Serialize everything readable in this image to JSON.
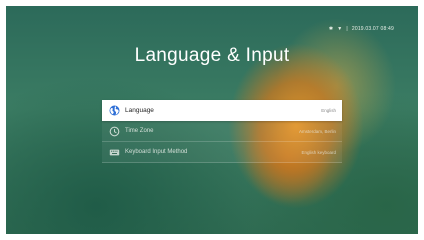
{
  "status_bar": {
    "bluetooth_icon": "bluetooth-icon",
    "wifi_icon": "wifi-icon",
    "separator": "|",
    "datetime": "2019.03.07  08:49"
  },
  "page": {
    "title": "Language & Input"
  },
  "menu": {
    "items": [
      {
        "label": "Language",
        "value": "English",
        "icon": "globe-icon",
        "selected": true
      },
      {
        "label": "Time Zone",
        "value": "Amsterdam, Berlin",
        "icon": "clock-icon",
        "selected": false
      },
      {
        "label": "Keyboard Input Method",
        "value": "English keyboard",
        "icon": "keyboard-icon",
        "selected": false
      }
    ]
  },
  "colors": {
    "accent_blue": "#2f6fd6",
    "selected_background": "#ffffff",
    "title_text": "#ffffff"
  }
}
